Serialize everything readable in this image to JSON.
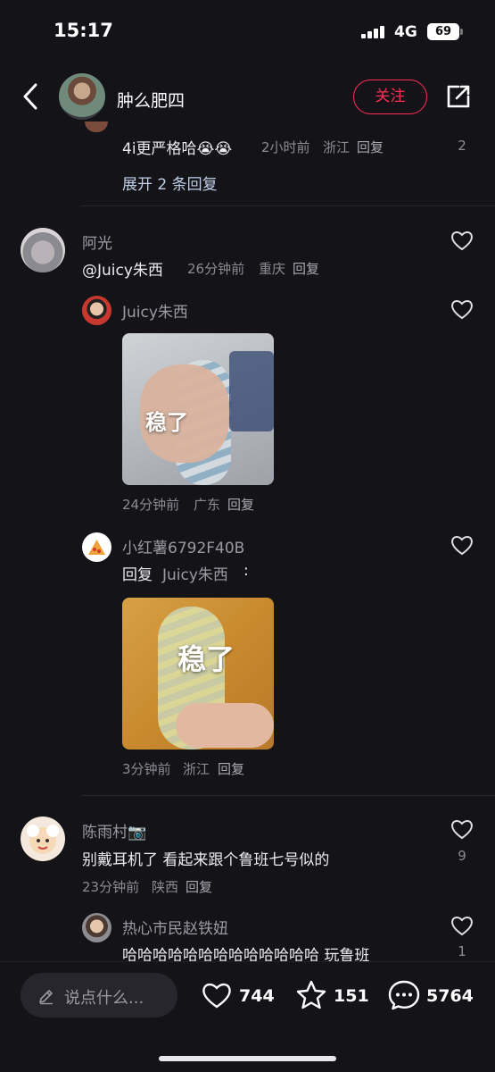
{
  "status_bar": {
    "time": "15:17",
    "network": "4G",
    "battery": "69"
  },
  "header": {
    "user_name": "肿么肥四",
    "follow_label": "关注"
  },
  "top_reply": {
    "text": "4i更严格哈😭😭",
    "time": "2小时前",
    "location": "浙江",
    "reply_label": "回复",
    "likes": "2",
    "expand_label": "展开 2 条回复"
  },
  "comments": {
    "c1": {
      "user": "阿光",
      "mention": "@Juicy朱西",
      "time": "26分钟前",
      "location": "重庆",
      "reply_label": "回复",
      "replies": {
        "r1": {
          "user": "Juicy朱西",
          "image_text": "稳了",
          "time": "24分钟前",
          "location": "广东",
          "reply_label": "回复"
        },
        "r2": {
          "user": "小红薯6792F40B",
          "reply_prefix": "回复",
          "reply_to": "Juicy朱西",
          "reply_colon": ":",
          "image_text": "稳了",
          "time": "3分钟前",
          "location": "浙江",
          "reply_label": "回复"
        }
      }
    },
    "c2": {
      "user": "陈雨村📷",
      "text": "别戴耳机了 看起来跟个鲁班七号似的",
      "likes": "9",
      "time": "23分钟前",
      "location": "陕西",
      "reply_label": "回复",
      "replies": {
        "r1": {
          "user": "热心市民赵铁妞",
          "text": "哈哈哈哈哈哈哈哈哈哈哈哈哈 玩鲁班",
          "likes": "1"
        }
      }
    }
  },
  "bottom_bar": {
    "input_placeholder": "说点什么...",
    "likes": "744",
    "favorites": "151",
    "comments": "5764"
  },
  "colors": {
    "accent": "#ff2d55",
    "background": "#141418",
    "meta": "#8b8b92"
  }
}
